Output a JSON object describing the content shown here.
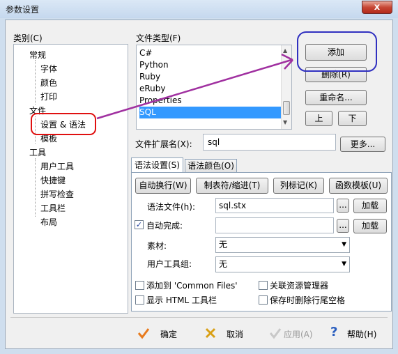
{
  "window": {
    "title": "参数设置",
    "close": "x"
  },
  "category": {
    "label": "类别(C)",
    "items": [
      {
        "label": "常规",
        "level": 0
      },
      {
        "label": "字体",
        "level": 1
      },
      {
        "label": "颜色",
        "level": 1
      },
      {
        "label": "打印",
        "level": 1
      },
      {
        "label": "文件",
        "level": 0
      },
      {
        "label": "设置 & 语法",
        "level": 1,
        "selected": true
      },
      {
        "label": "模板",
        "level": 1
      },
      {
        "label": "工具",
        "level": 0
      },
      {
        "label": "用户工具",
        "level": 1
      },
      {
        "label": "快捷键",
        "level": 1
      },
      {
        "label": "拼写检查",
        "level": 1
      },
      {
        "label": "工具栏",
        "level": 1
      },
      {
        "label": "布局",
        "level": 1
      }
    ]
  },
  "filetype": {
    "label": "文件类型(F)",
    "items": [
      "C#",
      "Python",
      "Ruby",
      "eRuby",
      "Properties",
      "SQL"
    ],
    "selected": "SQL",
    "add": "添加",
    "delete": "删除(R)",
    "rename": "重命名...",
    "up": "上",
    "down": "下"
  },
  "extension": {
    "label": "文件扩展名(X):",
    "value": "sql",
    "more": "更多..."
  },
  "tabs": [
    {
      "label": "语法设置(S)",
      "active": true
    },
    {
      "label": "语法颜色(O)",
      "active": false
    }
  ],
  "toolbar": {
    "wrap": "自动换行(W)",
    "tab": "制表符/缩进(T)",
    "column": "列标记(K)",
    "func": "函数模板(U)"
  },
  "syntax": {
    "label": "语法文件(h):",
    "value": "sql.stx",
    "browse": "...",
    "load": "加载"
  },
  "autocomplete": {
    "label": "自动完成:",
    "checked": "✓",
    "value": "",
    "browse": "...",
    "load": "加载"
  },
  "material": {
    "label": "素材:",
    "value": "无",
    "arrow": "▼"
  },
  "usertools": {
    "label": "用户工具组:",
    "value": "无",
    "arrow": "▼"
  },
  "checks": {
    "common": "添加到 'Common Files'",
    "explorer": "关联资源管理器",
    "html": "显示 HTML 工具栏",
    "trim": "保存时删除行尾空格"
  },
  "footer": {
    "ok": "确定",
    "cancel": "取消",
    "apply": "应用(A)",
    "help": "帮助(H)"
  },
  "colors": {
    "annotation_red": "#e01010",
    "annotation_blue": "#3030c0",
    "annotation_arrow": "#a030a0",
    "selection": "#3399ff"
  }
}
